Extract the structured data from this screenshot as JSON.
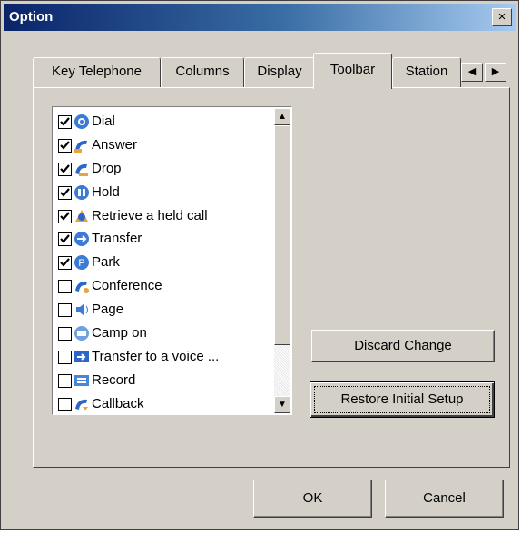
{
  "window": {
    "title": "Option",
    "close_glyph": "×"
  },
  "tabs": [
    {
      "label": "Key Telephone",
      "active": false
    },
    {
      "label": "Columns",
      "active": false
    },
    {
      "label": "Display",
      "active": false
    },
    {
      "label": "Toolbar",
      "active": true
    },
    {
      "label": "Station",
      "active": false
    }
  ],
  "tab_scroll": {
    "left_glyph": "◀",
    "right_glyph": "▶"
  },
  "list": {
    "scroll_up_glyph": "▲",
    "scroll_down_glyph": "▼",
    "items": [
      {
        "label": "Dial",
        "checked": true,
        "icon": "dial-icon"
      },
      {
        "label": "Answer",
        "checked": true,
        "icon": "answer-icon"
      },
      {
        "label": "Drop",
        "checked": true,
        "icon": "drop-icon"
      },
      {
        "label": "Hold",
        "checked": true,
        "icon": "hold-icon"
      },
      {
        "label": "Retrieve a held call",
        "checked": true,
        "icon": "retrieve-icon"
      },
      {
        "label": "Transfer",
        "checked": true,
        "icon": "transfer-icon"
      },
      {
        "label": "Park",
        "checked": true,
        "icon": "park-icon"
      },
      {
        "label": "Conference",
        "checked": false,
        "icon": "conference-icon"
      },
      {
        "label": "Page",
        "checked": false,
        "icon": "speaker-icon"
      },
      {
        "label": "Camp on",
        "checked": false,
        "icon": "camp-on-icon"
      },
      {
        "label": "Transfer to a voice ...",
        "checked": false,
        "icon": "voice-transfer-icon"
      },
      {
        "label": "Record",
        "checked": false,
        "icon": "record-icon"
      },
      {
        "label": "Callback",
        "checked": false,
        "icon": "callback-icon"
      }
    ]
  },
  "buttons": {
    "discard": "Discard Change",
    "restore": "Restore Initial Setup",
    "ok": "OK",
    "cancel": "Cancel"
  },
  "colors": {
    "title_gradient_start": "#0a246a",
    "title_gradient_end": "#a6caf0",
    "dialog_face": "#d4d0c8"
  }
}
